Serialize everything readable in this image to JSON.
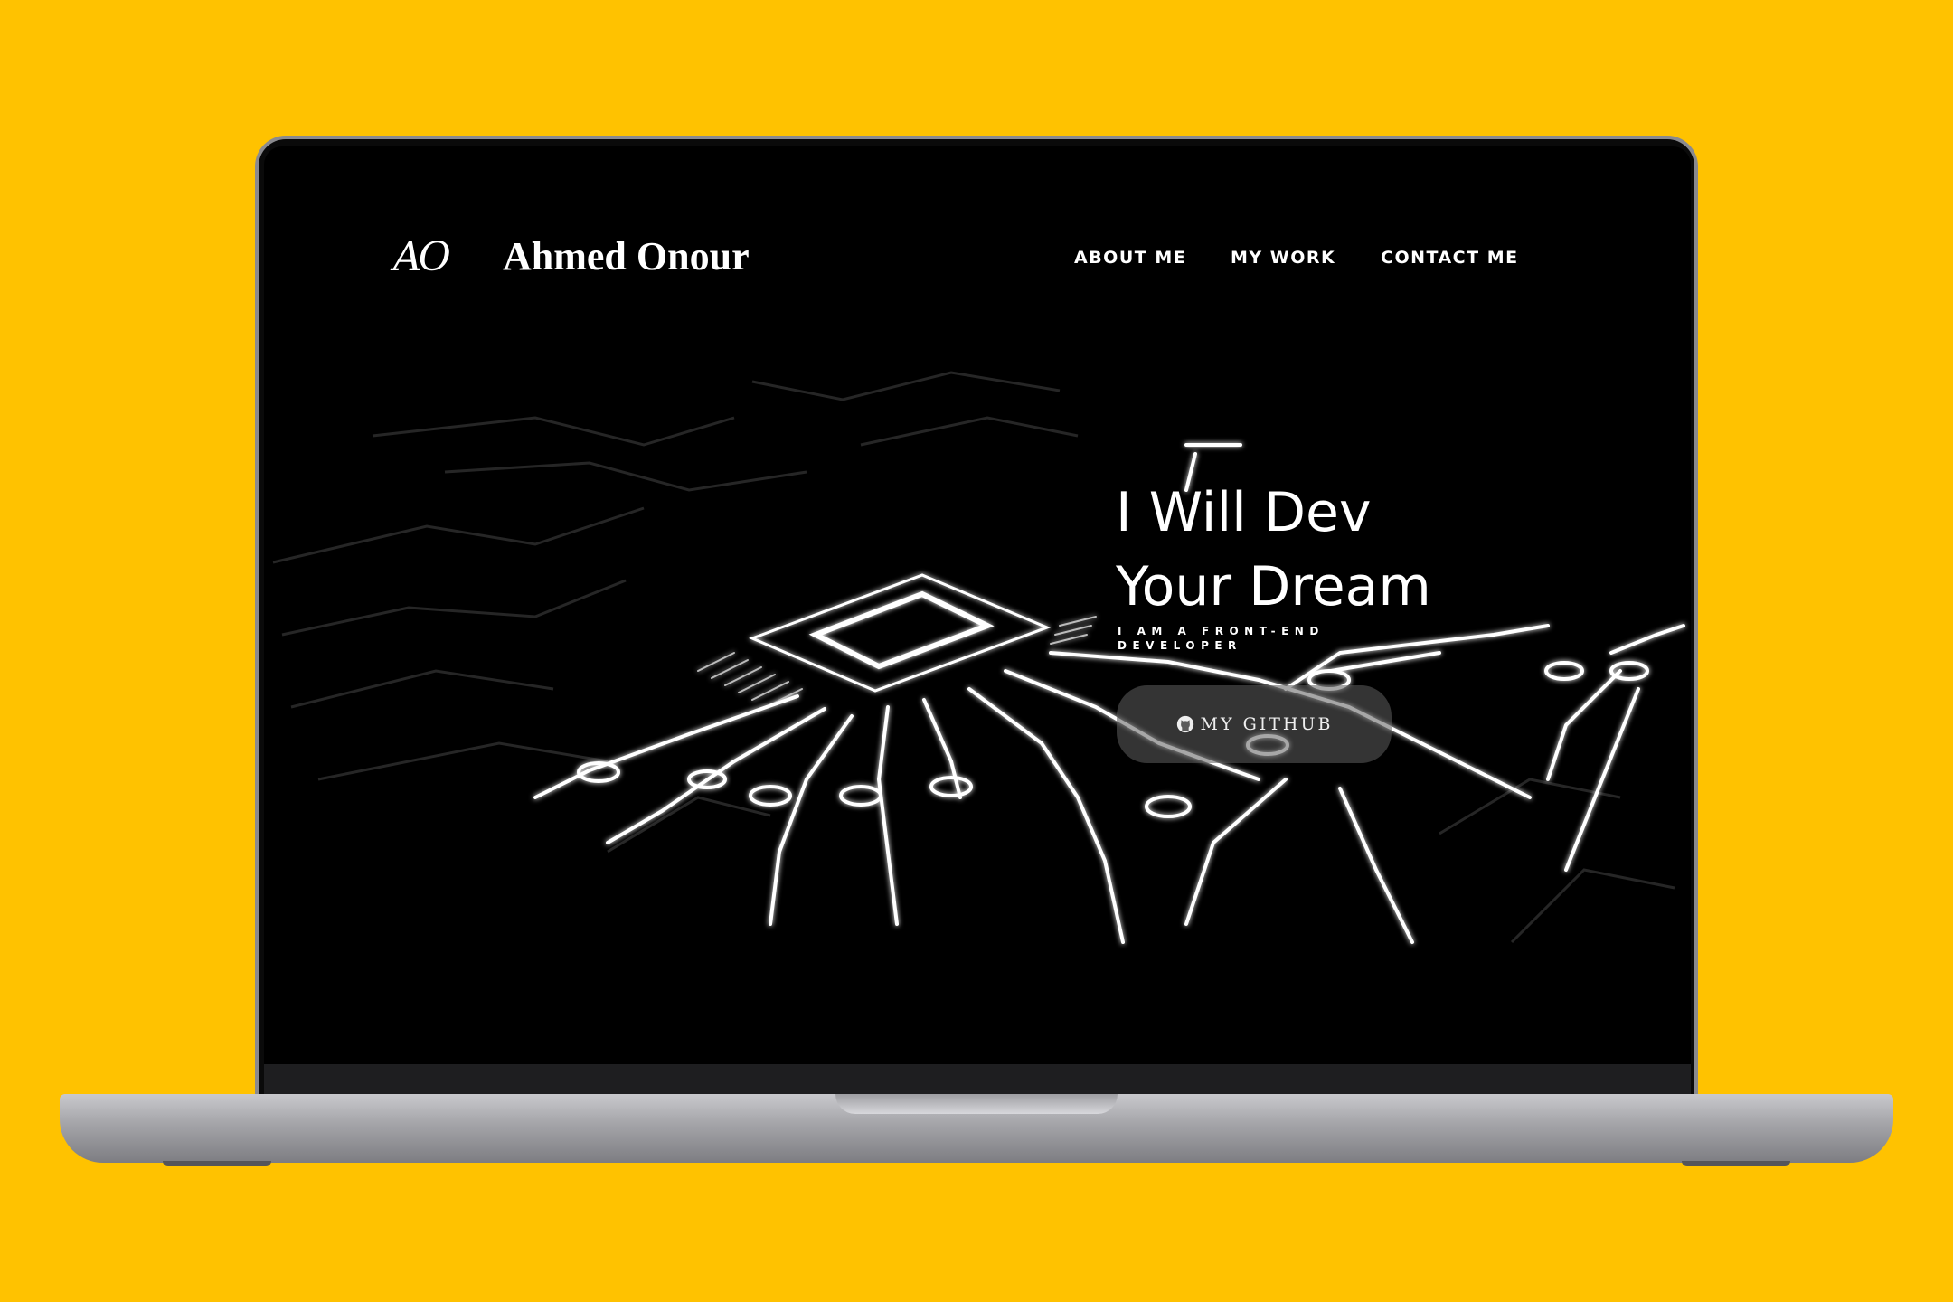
{
  "header": {
    "logo_mark": "AO",
    "brand_name": "Ahmed Onour",
    "nav": [
      {
        "label": "ABOUT ME"
      },
      {
        "label": "MY WORK"
      },
      {
        "label": "CONTACT ME"
      }
    ]
  },
  "hero": {
    "headline_line1": "I Will Dev",
    "headline_line2": "Your Dream",
    "subtitle": "I AM A FRONT-END DEVELOPER",
    "cta_label": "MY GITHUB",
    "cta_icon": "github-icon"
  },
  "colors": {
    "background": "#FFC200",
    "screen": "#000000",
    "text": "#FFFFFF",
    "button": "#5F5F5F"
  }
}
